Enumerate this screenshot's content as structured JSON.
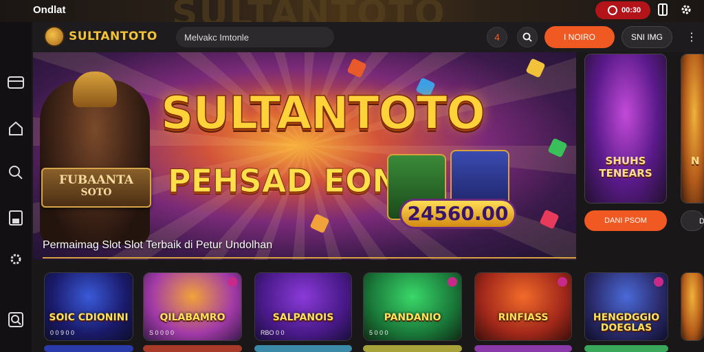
{
  "topbar": {
    "brand_small": "Ondlat",
    "background_word": "SULTANTOTO",
    "clock_text": "00:30"
  },
  "header": {
    "brand_name": "SULTANTOTO",
    "search_value": "Melvakc Imtonle",
    "notif_count": "4",
    "primary_button": "I NOIRO",
    "secondary_button": "SNI IMG"
  },
  "hero": {
    "title_main": "SULTANTOTO",
    "title_sub": "PEHSAD EONS",
    "banner_line1": "FUBAANTA",
    "banner_line2": "SOTO",
    "jackpot": "24560.00",
    "caption": "Permaimag Slot Slot Terbaik di Petur Undolhan"
  },
  "side_cards": [
    {
      "title": "SHUHS TENEARS",
      "button": "DANI PSOM"
    },
    {
      "title": "N",
      "button": "D"
    }
  ],
  "games": [
    {
      "title": "SOIC CDIONINI",
      "subtitle": "0 0 9 0 0"
    },
    {
      "title": "QILABAMRO",
      "subtitle": "S 0 0 0 0"
    },
    {
      "title": "SALPANOIS",
      "subtitle": "RBO 0 0"
    },
    {
      "title": "PANDANIO",
      "subtitle": "5 0 0 0"
    },
    {
      "title": "RINFIASS",
      "subtitle": ""
    },
    {
      "title": "HENGDGGIO DOEGLAS",
      "subtitle": ""
    },
    {
      "title": "",
      "subtitle": ""
    }
  ],
  "colors": {
    "accent": "#f05a22",
    "brand_gold": "#f2c23a",
    "clock_red": "#b3141a"
  },
  "icons": {
    "rail": [
      "card-icon",
      "home-icon",
      "search-icon",
      "save-icon",
      "settings-icon",
      "zoom-icon"
    ]
  }
}
